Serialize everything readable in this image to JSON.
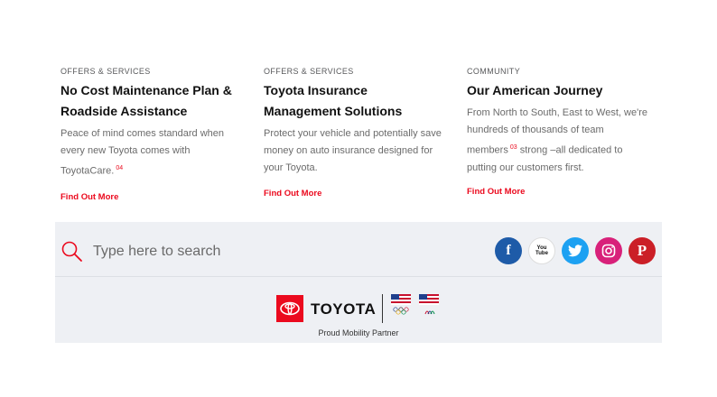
{
  "cards": [
    {
      "eyebrow": "OFFERS & SERVICES",
      "title": "No Cost Maintenance Plan & Roadside Assistance",
      "description": "Peace of mind comes standard when every new Toyota comes with ToyotaCare.",
      "sup": "04",
      "link": "Find Out More"
    },
    {
      "eyebrow": "OFFERS & SERVICES",
      "title": "Toyota Insurance Management Solutions",
      "description": "Protect your vehicle and potentially save money on auto insurance designed for your Toyota.",
      "link": "Find Out More"
    },
    {
      "eyebrow": "COMMUNITY",
      "title": "Our American Journey",
      "description_pre": "From North to South, East to West, we're hundreds of thousands of team members",
      "sup": "03",
      "description_post": "strong –all dedicated to putting our customers first.",
      "link": "Find Out More"
    }
  ],
  "search": {
    "placeholder": "Type here to search"
  },
  "social": {
    "facebook": "f",
    "youtube": "You Tube",
    "twitter": "twitter",
    "instagram": "instagram",
    "pinterest": "P"
  },
  "brand": {
    "wordmark": "TOYOTA",
    "tagline": "Proud Mobility Partner",
    "accent": "#eb0a1e"
  }
}
